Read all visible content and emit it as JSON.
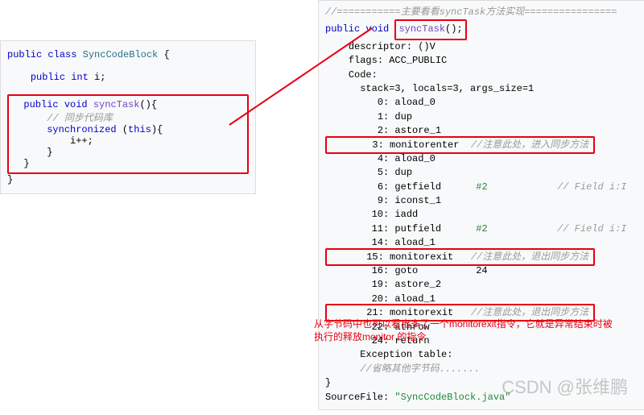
{
  "left": {
    "l1a": "public",
    "l1b": "class",
    "l1c": "SyncCodeBlock",
    "l1d": " {",
    "l2a": "public",
    "l2b": "int",
    "l2c": " i;",
    "l3a": "public",
    "l3b": "void",
    "l3c": "syncTask",
    "l3d": "(){",
    "l4": "// 同步代码库",
    "l5a": "synchronized",
    "l5b": " (",
    "l5c": "this",
    "l5d": "){",
    "l6": "i++;",
    "l7": "}",
    "l8": "}",
    "l9": "}"
  },
  "right": {
    "r0": "//===========主要看看syncTask方法实现================",
    "r1a": "public",
    "r1b": "void",
    "r1c": "syncTask",
    "r1d": "();",
    "r2": "descriptor: ()V",
    "r3": "flags: ACC_PUBLIC",
    "r4": "Code:",
    "r5": "stack=3, locals=3, args_size=1",
    "b0": "0: aload_0",
    "b1": "1: dup",
    "b2": "2: astore_1",
    "b3a": "3: monitorenter",
    "b3c": "//注意此处，进入同步方法",
    "b4": "4: aload_0",
    "b5": "5: dup",
    "b6a": "6: getfield",
    "b6b": "#2",
    "b6c": "// Field i:I",
    "b9": "9: iconst_1",
    "b10": "10: iadd",
    "b11a": "11: putfield",
    "b11b": "#2",
    "b11c": "// Field i:I",
    "b14": "14: aload_1",
    "b15a": "15: monitorexit",
    "b15c": "//注意此处，退出同步方法",
    "b16": "16: goto          24",
    "b19": "19: astore_2",
    "b20": "20: aload_1",
    "b21a": "21: monitorexit",
    "b21c": "//注意此处，退出同步方法",
    "b22": "22: athrow",
    "b24": "24: return",
    "et": "Exception table:",
    "omit": "//省略其他字节码.......",
    "brace": "}",
    "sf1": "SourceFile: ",
    "sf2": "\"SyncCodeBlock.java\""
  },
  "annotation": {
    "line1": "从字节码中也可以看出多了一个monitorexit指令，它就是异常结束时被",
    "line2": "执行的释放monitor 的指令"
  },
  "watermark": "CSDN @张维鹏"
}
